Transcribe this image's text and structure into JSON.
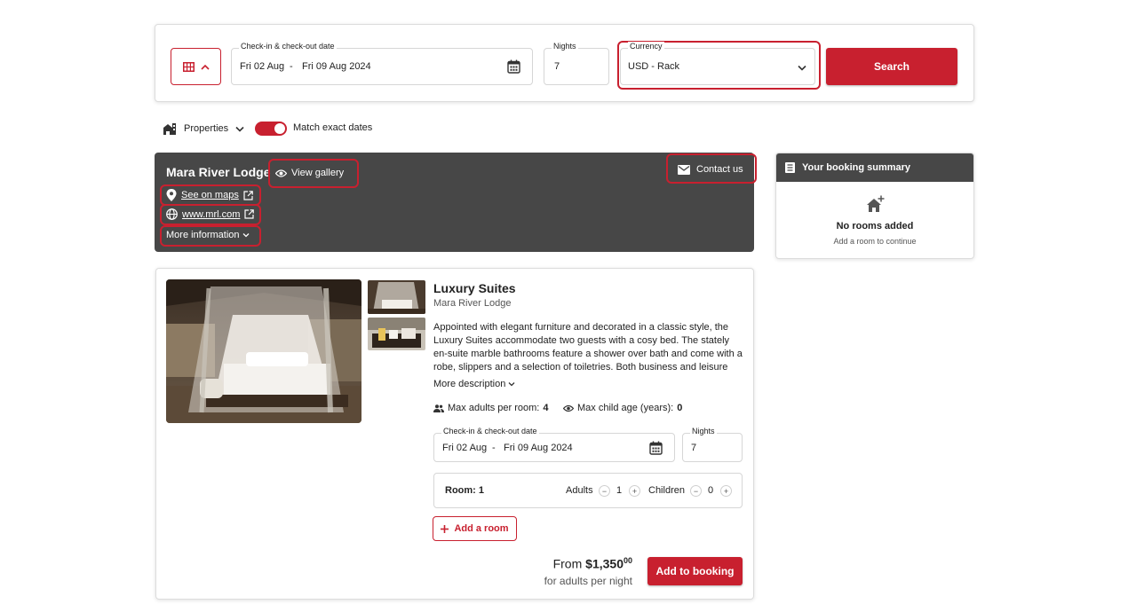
{
  "search": {
    "dates_label": "Check-in & check-out date",
    "checkin": "Fri 02 Aug",
    "dash": "-",
    "checkout": "Fri 09 Aug 2024",
    "nights_label": "Nights",
    "nights_value": "7",
    "currency_label": "Currency",
    "currency_value": "USD - Rack",
    "search_label": "Search"
  },
  "filters": {
    "properties_label": "Properties",
    "match_exact_label": "Match exact dates",
    "match_exact_on": true
  },
  "property": {
    "name": "Mara River Lodge",
    "view_gallery": "View gallery",
    "contact": "Contact us",
    "maps": "See on maps",
    "website": "www.mrl.com",
    "more_info": "More information"
  },
  "summary": {
    "title": "Your booking summary",
    "empty_title": "No rooms added",
    "empty_sub": "Add a room to continue"
  },
  "room": {
    "title": "Luxury Suites",
    "subtitle": "Mara River Lodge",
    "description": "Appointed with elegant furniture and decorated in a classic style, the Luxury Suites accommodate two guests with a cosy bed. The stately en-suite marble bathrooms feature a shower over bath and come with a robe, slippers and a selection of toiletries. Both business and leisure",
    "more_description": "More description",
    "max_adults_label": "Max adults per room:",
    "max_adults_value": "4",
    "max_child_label": "Max child age (years):",
    "max_child_value": "0",
    "dates_label": "Check-in & check-out date",
    "checkin": "Fri 02 Aug",
    "dash": "-",
    "checkout": "Fri 09 Aug 2024",
    "nights_label": "Nights",
    "nights_value": "7",
    "room_label": "Room: 1",
    "adults_label": "Adults",
    "adults_value": "1",
    "children_label": "Children",
    "children_value": "0",
    "add_room": "Add a room",
    "price_from": "From",
    "price_main": "$1,350",
    "price_cents": "00",
    "price_note": "for adults per night",
    "add_booking": "Add to booking"
  },
  "colors": {
    "accent": "#c8202f",
    "header_bg": "#474747"
  }
}
